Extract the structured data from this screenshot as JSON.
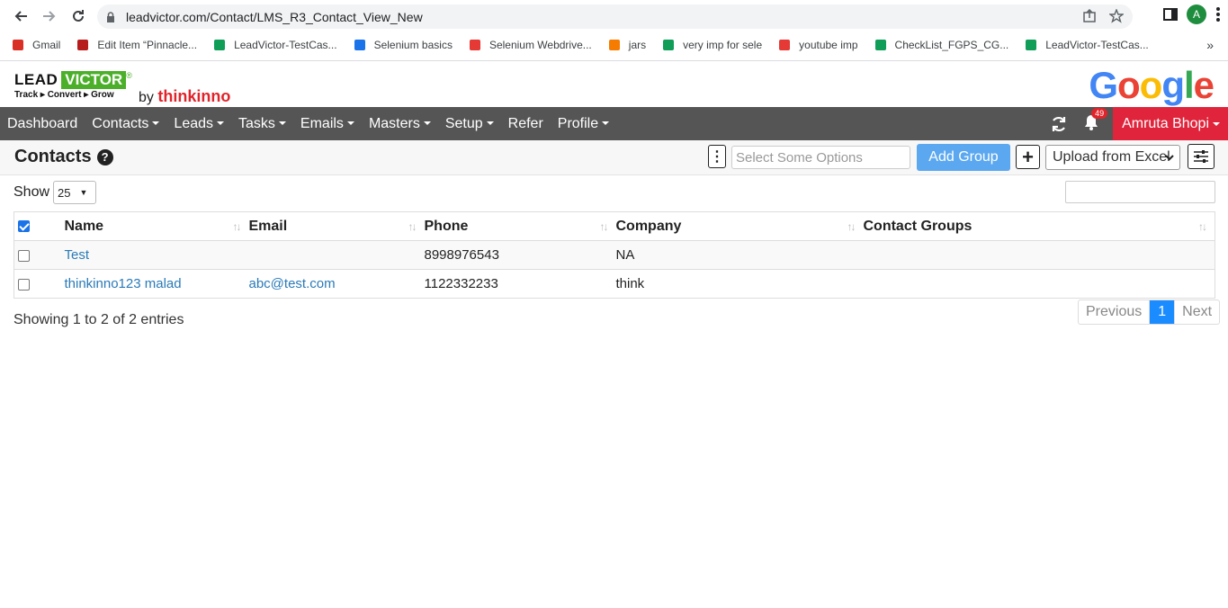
{
  "browser": {
    "url": "leadvictor.com/Contact/LMS_R3_Contact_View_New",
    "profile_initial": "A",
    "bookmarks": [
      {
        "label": "Gmail",
        "icon": "gmail-icon",
        "color": "#d93025"
      },
      {
        "label": "Edit Item “Pinnacle...",
        "icon": "pinnacle-icon",
        "color": "#b71c1c"
      },
      {
        "label": "LeadVictor-TestCas...",
        "icon": "sheets-icon",
        "color": "#0f9d58"
      },
      {
        "label": "Selenium basics",
        "icon": "selenium-icon",
        "color": "#1a73e8"
      },
      {
        "label": "Selenium Webdrive...",
        "icon": "selenium-webdriver-icon",
        "color": "#e53935"
      },
      {
        "label": "jars",
        "icon": "blogger-icon",
        "color": "#f57c00"
      },
      {
        "label": "very imp for sele",
        "icon": "s-icon",
        "color": "#0f9d58"
      },
      {
        "label": "youtube imp",
        "icon": "youtube-icon",
        "color": "#e53935"
      },
      {
        "label": "CheckList_FGPS_CG...",
        "icon": "sheets-icon",
        "color": "#0f9d58"
      },
      {
        "label": "LeadVictor-TestCas...",
        "icon": "sheets-icon",
        "color": "#0f9d58"
      }
    ]
  },
  "header": {
    "logo_lead": "LEAD",
    "logo_victor": "VICTOR",
    "logo_reg": "®",
    "logo_tagline": "Track ▸ Convert ▸ Grow",
    "logo_by": "by",
    "logo_brand": "thinkinno",
    "google_logo": "Google"
  },
  "nav": {
    "items": [
      {
        "label": "Dashboard",
        "dropdown": false
      },
      {
        "label": "Contacts",
        "dropdown": true
      },
      {
        "label": "Leads",
        "dropdown": true
      },
      {
        "label": "Tasks",
        "dropdown": true
      },
      {
        "label": "Emails",
        "dropdown": true
      },
      {
        "label": "Masters",
        "dropdown": true
      },
      {
        "label": "Setup",
        "dropdown": true
      },
      {
        "label": "Refer",
        "dropdown": false
      },
      {
        "label": "Profile",
        "dropdown": true
      }
    ],
    "notification_count": "49",
    "user_name": "Amruta Bhopi"
  },
  "toolbar": {
    "title": "Contacts",
    "help": "?",
    "kebab": "⋮",
    "select_placeholder": "Select Some Options",
    "add_group_label": "Add Group",
    "plus_label": "+",
    "upload_label": "Upload from Excel"
  },
  "table": {
    "show_label": "Show",
    "page_length": "25",
    "columns": [
      "Name",
      "Email",
      "Phone",
      "Company",
      "Contact Groups"
    ],
    "rows": [
      {
        "name": "Test",
        "email": "",
        "phone": "8998976543",
        "company": "NA",
        "groups": ""
      },
      {
        "name": "thinkinno123 malad",
        "email": "abc@test.com",
        "phone": "1122332233",
        "company": "think",
        "groups": ""
      }
    ],
    "info": "Showing 1 to 2 of 2 entries",
    "pagination": {
      "previous": "Previous",
      "current": "1",
      "next": "Next"
    }
  },
  "colors": {
    "navbar": "#555555",
    "user_button": "#e0243b",
    "add_group": "#5ba8f0",
    "link": "#2a7ab8",
    "active_page": "#1a8cff",
    "brand_green": "#4caf2a",
    "brand_red": "#e0242b"
  }
}
